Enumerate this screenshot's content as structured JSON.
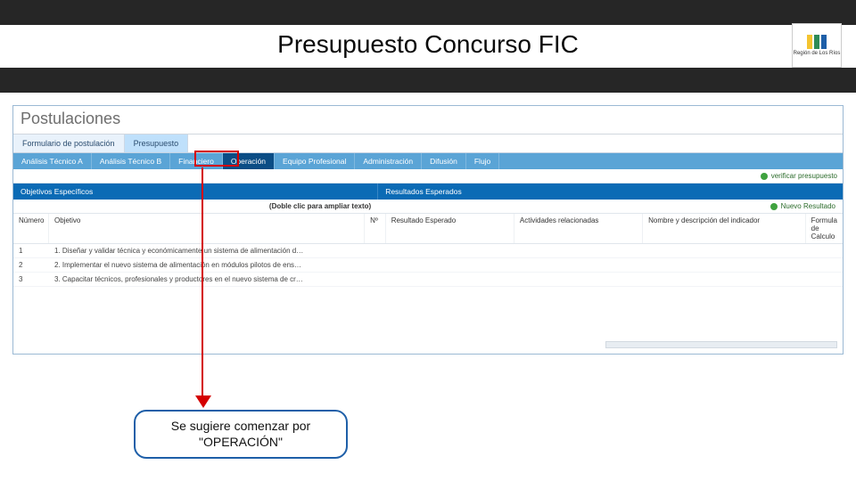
{
  "header": {
    "title": "Presupuesto Concurso FIC",
    "logo_text": "Región de Los Ríos"
  },
  "app": {
    "section_title": "Postulaciones",
    "outer_tabs": [
      {
        "label": "Formulario de postulación",
        "active": false
      },
      {
        "label": "Presupuesto",
        "active": true
      }
    ],
    "inner_tabs": [
      {
        "label": "Análisis Técnico A"
      },
      {
        "label": "Análisis Técnico B"
      },
      {
        "label": "Financiero"
      },
      {
        "label": "Operación",
        "active": true
      },
      {
        "label": "Equipo Profesional"
      },
      {
        "label": "Administración"
      },
      {
        "label": "Difusión"
      },
      {
        "label": "Flujo"
      }
    ],
    "toolbar": {
      "verify_label": "verificar presupuesto",
      "new_result_label": "Nuevo Resultado"
    },
    "panels": {
      "left_title": "Objetivos Específicos",
      "right_title": "Resultados Esperados",
      "hint": "(Doble clic para ampliar texto)"
    },
    "columns": {
      "numero": "Número",
      "objetivo": "Objetivo",
      "n": "Nº",
      "resultado": "Resultado Esperado",
      "actividades": "Actividades relacionadas",
      "indicador": "Nombre y descripción del indicador",
      "formula": "Formula de Calculo"
    },
    "rows": [
      {
        "n": "1",
        "obj": "1. Diseñar y validar técnica y económicamente un sistema de alimentación d…"
      },
      {
        "n": "2",
        "obj": "2. Implementar el nuevo sistema de alimentación en módulos pilotos de ens…"
      },
      {
        "n": "3",
        "obj": "3. Capacitar técnicos, profesionales y productores en el nuevo sistema de cr…"
      }
    ]
  },
  "callout": {
    "line1": "Se sugiere comenzar por",
    "line2": "\"OPERACIÓN\""
  }
}
